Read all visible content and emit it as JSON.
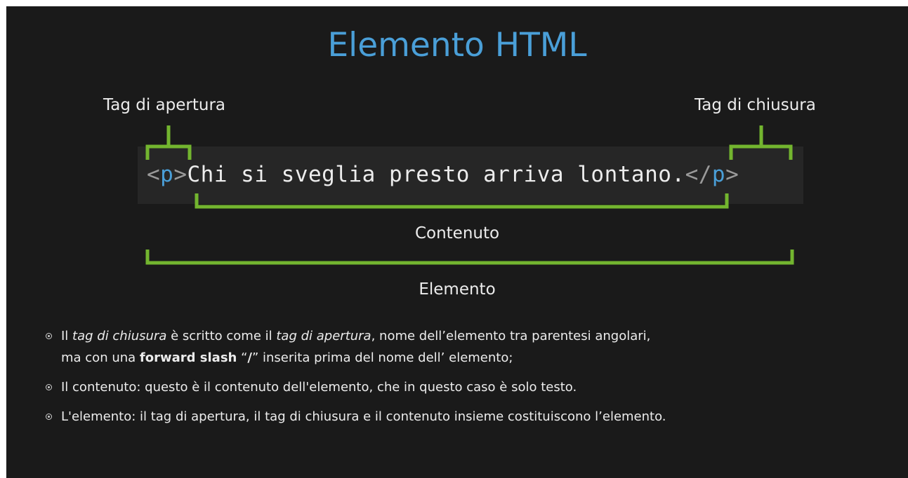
{
  "title": "Elemento HTML",
  "labels": {
    "opening_tag": "Tag di apertura",
    "closing_tag": "Tag di chiusura",
    "content": "Contenuto",
    "element": "Elemento"
  },
  "code": {
    "lt": "<",
    "gt": ">",
    "tag_name": "p",
    "slash": "/",
    "text": "Chi si sveglia presto arriva lontano."
  },
  "colors": {
    "background": "#1a1a1a",
    "title": "#4a9fd8",
    "bracket": "#73b52f",
    "code_box": "#262626"
  },
  "bullets": [
    {
      "line1": {
        "t1": "Il ",
        "em1": "tag di chiusura",
        "t2": " è scritto come il ",
        "em2": "tag di apertura",
        "t3": ", nome dell’elemento tra parentesi angolari,"
      },
      "line2": {
        "t1": "ma con una ",
        "strong": "forward slash",
        "t2": " “",
        "slash": "/",
        "t3": "” inserita prima del nome dell’ elemento;"
      }
    },
    {
      "text": "Il contenuto: questo è il contenuto dell'elemento, che in questo caso è solo testo."
    },
    {
      "text": "L'elemento: il tag di apertura, il tag di chiusura e il contenuto insieme costituiscono l’elemento."
    }
  ]
}
